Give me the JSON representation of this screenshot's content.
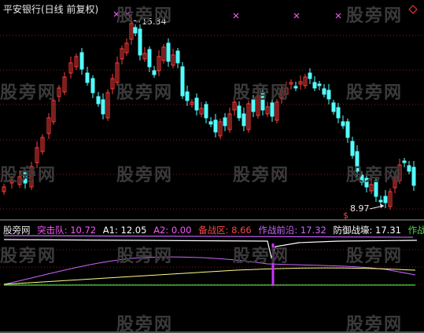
{
  "title": "平安银行(日线 前复权)",
  "price": {
    "high_label": "15.34",
    "low_label": "8.97",
    "signal_mark": "$"
  },
  "watermark": "股旁网",
  "indicator": {
    "name": "股旁网",
    "items": [
      {
        "label": "突击队",
        "value": "10.72",
        "color": "#ff55ff"
      },
      {
        "label": "A1",
        "value": "12.05",
        "color": "#ffffff"
      },
      {
        "label": "A2",
        "value": "0.00",
        "color": "#ff55ff"
      },
      {
        "label": "备战区",
        "value": "8.66",
        "color": "#ff4444"
      },
      {
        "label": "作战前沿",
        "value": "17.32",
        "color": "#cc66ff"
      },
      {
        "label": "防御战壕",
        "value": "17.31",
        "color": "#ffffff"
      },
      {
        "label": "作战总",
        "value": "",
        "color": "#44dd44"
      }
    ]
  },
  "colors": {
    "up": "#ff3b3b",
    "down": "#54ffff",
    "grid": "#8b1a1a",
    "marker": "#ff55ff"
  }
}
